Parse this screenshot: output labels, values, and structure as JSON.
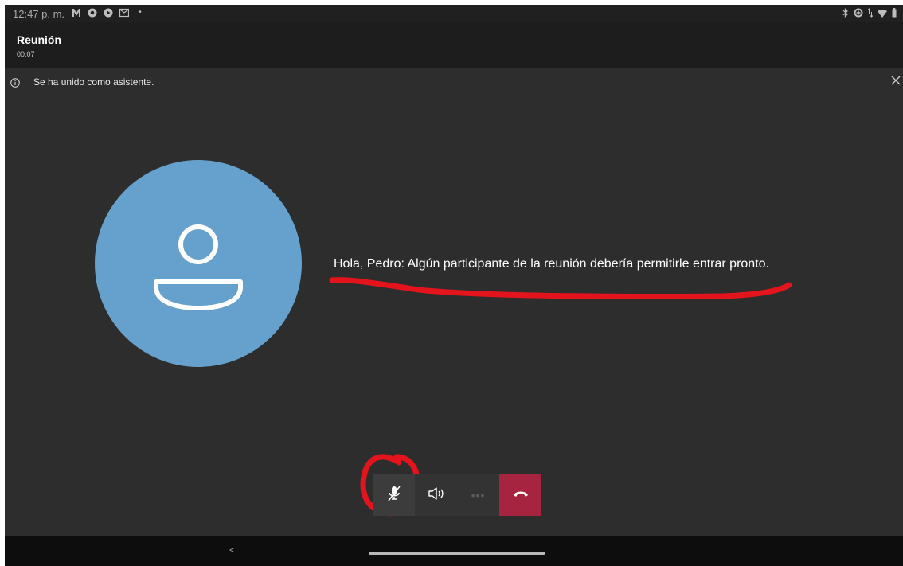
{
  "status_bar": {
    "time": "12:47 p. m.",
    "left_icons": [
      "m-icon",
      "chrome-icon",
      "play-icon",
      "mail-icon"
    ],
    "right_icons": [
      "bluetooth-icon",
      "data-saver-icon",
      "data-arrows-icon",
      "wifi-icon",
      "battery-icon"
    ]
  },
  "meeting": {
    "title": "Reunión",
    "timer": "00:07"
  },
  "banner": {
    "text": "Se ha unido como asistente."
  },
  "lobby": {
    "message": "Hola, Pedro: Algún participante de la reunión debería permitirle entrar pronto.",
    "avatar_color": "#65a1cc"
  },
  "toolbar": {
    "controls": [
      "mic-muted-icon",
      "speaker-icon",
      "more-options-icon",
      "hang-up-icon"
    ],
    "more_label": "•••",
    "hangup_color": "#a6243f"
  },
  "annotations": {
    "color": "#e3141b"
  },
  "nav": {
    "back_label": "<"
  }
}
